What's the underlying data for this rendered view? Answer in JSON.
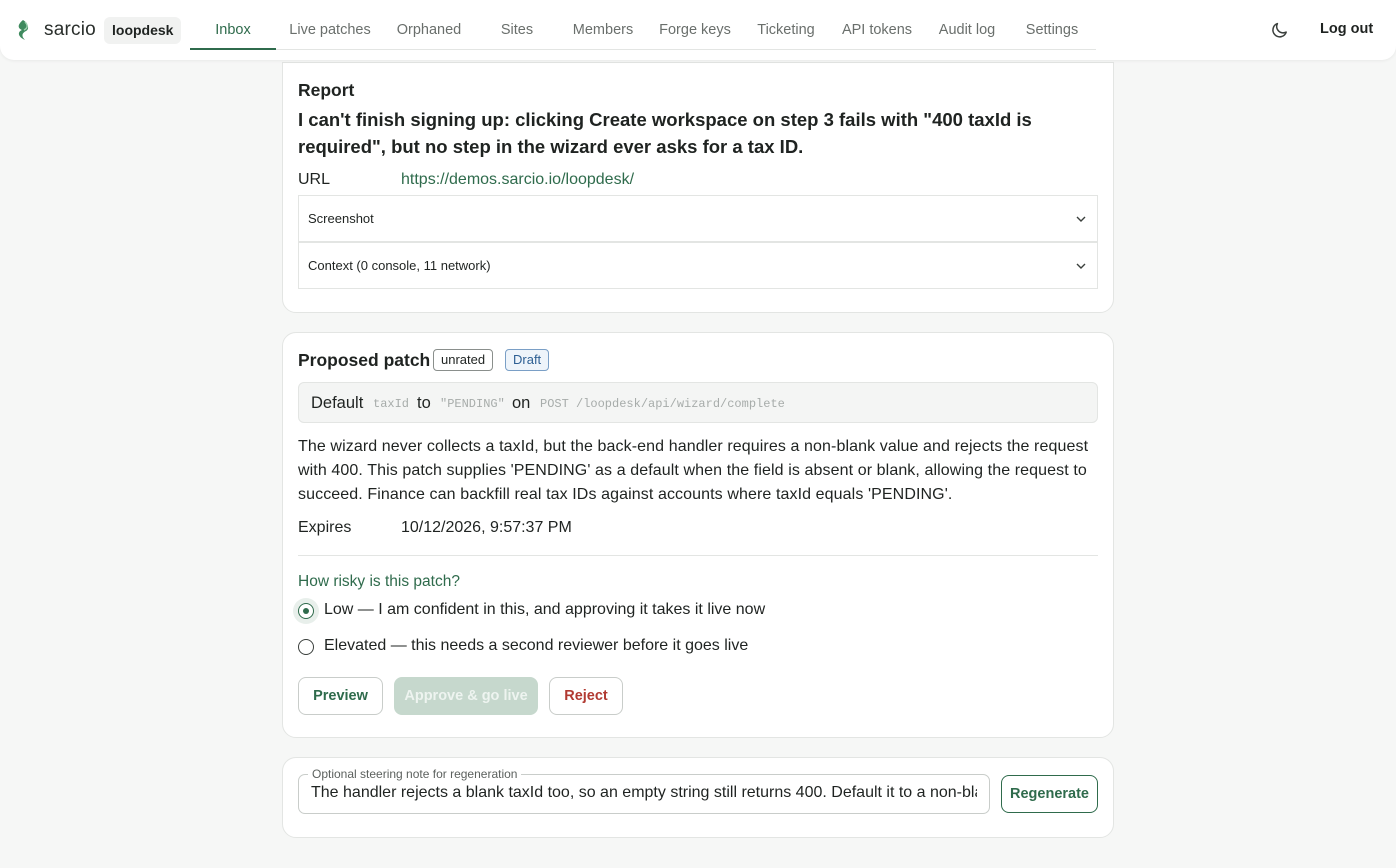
{
  "header": {
    "brand": "sarcio",
    "workspace": "loopdesk",
    "nav": [
      {
        "label": "Inbox",
        "active": true
      },
      {
        "label": "Live patches"
      },
      {
        "label": "Orphaned"
      },
      {
        "label": "Sites"
      },
      {
        "label": "Members"
      },
      {
        "label": "Forge keys"
      },
      {
        "label": "Ticketing"
      },
      {
        "label": "API tokens"
      },
      {
        "label": "Audit log"
      },
      {
        "label": "Settings"
      }
    ],
    "theme_icon": "moon-icon",
    "logout": "Log out"
  },
  "report": {
    "title": "Report",
    "text": "I can't finish signing up: clicking Create workspace on step 3 fails with \"400 taxId is required\", but no step in the wizard ever asks for a tax ID.",
    "url_label": "URL",
    "url": "https://demos.sarcio.io/loopdesk/",
    "screenshot_label": "Screenshot",
    "context_label": "Context (0 console, 11 network)"
  },
  "patch": {
    "title": "Proposed patch",
    "badge_rating": "unrated",
    "badge_status": "Draft",
    "summary": {
      "w1": "Default",
      "field": "taxId",
      "w2": "to",
      "value": "\"PENDING\"",
      "w3": "on",
      "endpoint": "POST /loopdesk/api/wizard/complete"
    },
    "description": "The wizard never collects a taxId, but the back-end handler requires a non-blank value and rejects the request with 400. This patch supplies 'PENDING' as a default when the field is absent or blank, allowing the request to succeed. Finance can backfill real tax IDs against accounts where taxId equals 'PENDING'.",
    "expires_label": "Expires",
    "expires_value": "10/12/2026, 9:57:37 PM",
    "risk_question": "How risky is this patch?",
    "risk_low": "Low — I am confident in this, and approving it takes it live now",
    "risk_elevated": "Elevated — this needs a second reviewer before it goes live",
    "btn_preview": "Preview",
    "btn_approve": "Approve & go live",
    "btn_reject": "Reject"
  },
  "regen": {
    "legend": "Optional steering note for regeneration",
    "value": "The handler rejects a blank taxId too, so an empty string still returns 400. Default it to a non-blank",
    "btn": "Regenerate"
  },
  "colors": {
    "accent": "#2f6b4c",
    "danger": "#b13a32",
    "draft": "#2d5f93"
  }
}
